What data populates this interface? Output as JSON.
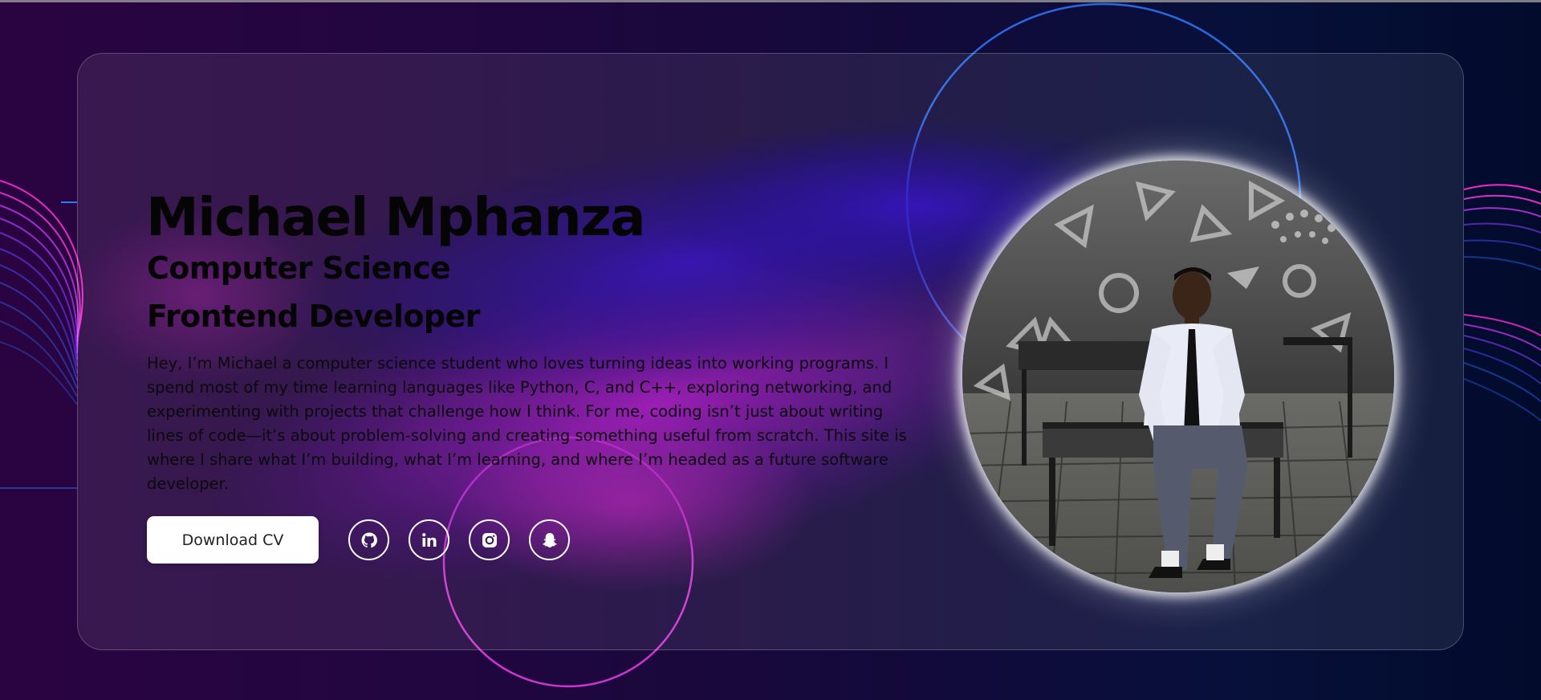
{
  "hero": {
    "name": "Michael Mphanza",
    "role_line_1": "Computer Science",
    "role_line_2": "Frontend Developer",
    "bio": "Hey, I’m Michael a computer science student who loves turning ideas into working programs. I spend most of my time learning languages like Python, C, and C++, exploring networking, and experimenting with projects that challenge how I think. For me, coding isn’t just about writing lines of code—it’s about problem-solving and creating something useful from scratch. This site is where I share what I’m building, what I’m learning, and where I’m headed as a future software developer.",
    "cv_button_label": "Download CV"
  },
  "socials": [
    {
      "name": "GitHub",
      "icon": "github-icon"
    },
    {
      "name": "LinkedIn",
      "icon": "linkedin-icon"
    },
    {
      "name": "Instagram",
      "icon": "instagram-icon"
    },
    {
      "name": "Snapchat",
      "icon": "snapchat-icon"
    }
  ],
  "photo": {
    "subject": "profile-photo"
  },
  "colors": {
    "background_left": "#2a0440",
    "background_right": "#020b2c",
    "glow_purple": "#a21fc4",
    "glow_violet": "#3a12c8",
    "text": "#050505",
    "button_bg": "#ffffff",
    "icon_border": "#ffffff",
    "neon_pink": "#ff2bd6",
    "neon_blue": "#2a6bff"
  }
}
